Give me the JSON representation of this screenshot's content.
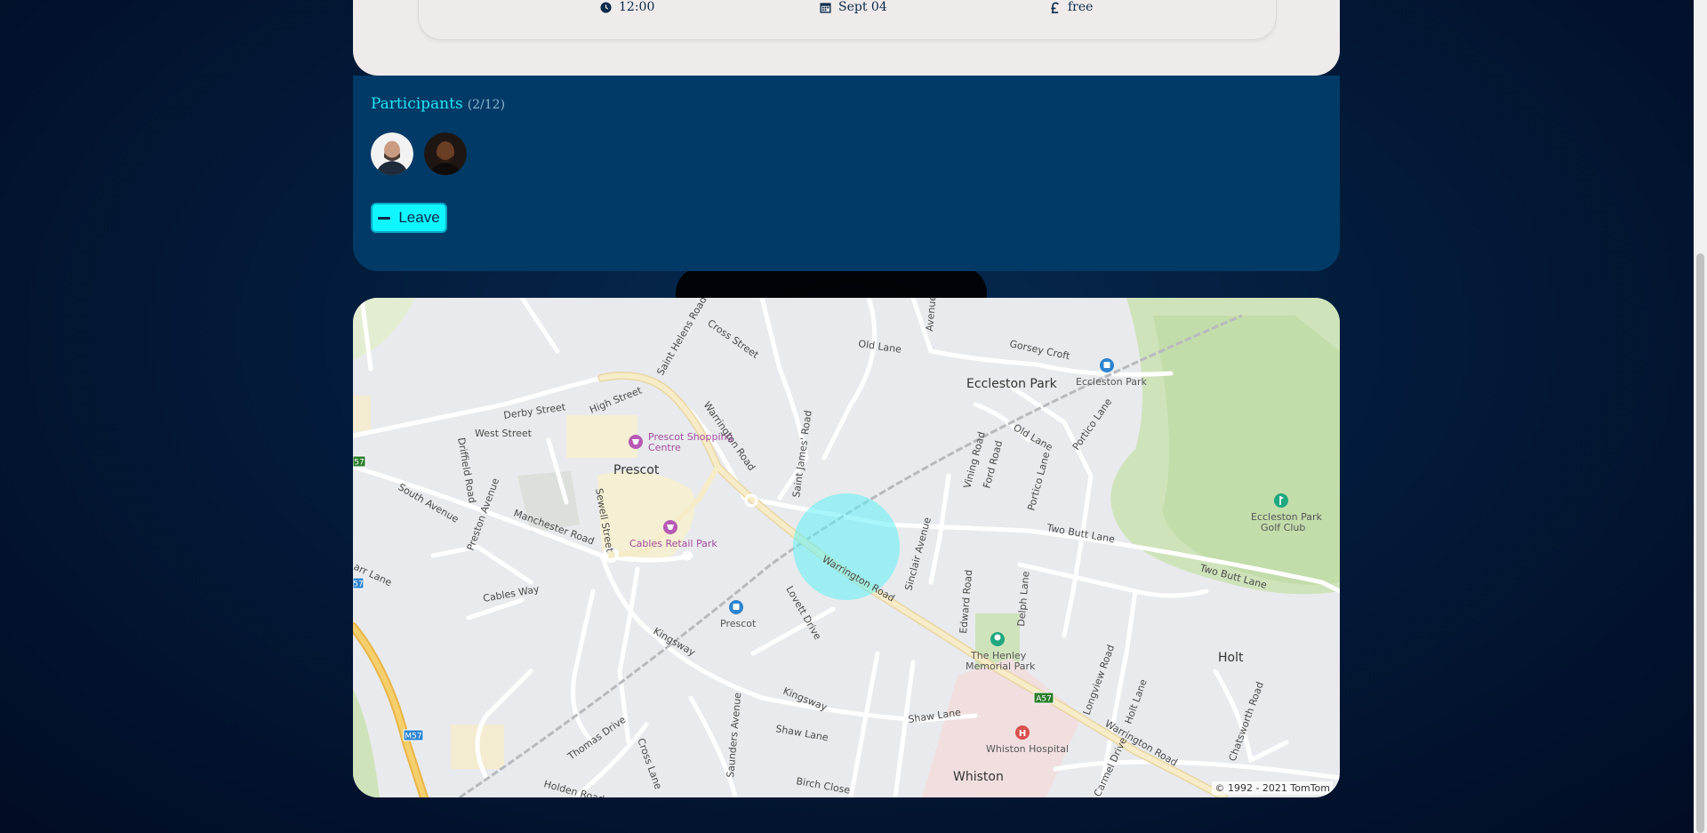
{
  "event_details": {
    "time": "12:00",
    "date": "Sept 04",
    "price": "free"
  },
  "participants": {
    "title": "Participants",
    "count": "(2/12)",
    "avatars": [
      "participant-1",
      "participant-2"
    ]
  },
  "leave_button": {
    "label": "Leave"
  },
  "map": {
    "copyright": "© 1992 - 2021 TomTom",
    "places": {
      "eccleston_park": "Eccleston Park",
      "eccleston_park_station": "Eccleston Park",
      "prescot": "Prescot",
      "prescot_station": "Prescot",
      "prescot_shopping": "Prescot Shopping",
      "prescot_centre": "Centre",
      "cables_retail": "Cables Retail Park",
      "henley_1": "The Henley",
      "henley_2": "Memorial Park",
      "whiston_hospital": "Whiston Hospital",
      "whiston": "Whiston",
      "holt": "Holt",
      "golf_1": "Eccleston Park",
      "golf_2": "Golf Club"
    },
    "roads": {
      "old_lane": "Old Lane",
      "old_lane_2": "Old Lane",
      "gorsey_croft": "Gorsey Croft",
      "cross_street": "Cross Street",
      "saint_helens_road": "Saint Helens Road",
      "derby_street": "Derby Street",
      "high_street": "High Street",
      "warrington_road_1": "Warrington Road",
      "warrington_road_2": "Warrington Road",
      "warrington_road_3": "Warrington Road",
      "west_street": "West Street",
      "driffield_road": "Driffield Road",
      "south_avenue": "South Avenue",
      "preston_avenue": "Preston Avenue",
      "manchester_road": "Manchester Road",
      "sewell_street": "Sewell Street",
      "saint_james_road": "Saint James' Road",
      "vining_road": "Vining Road",
      "ford_road": "Ford Road",
      "portico_lane": "Portico Lane",
      "portico_lane_2": "Portico Lane",
      "two_butt_lane": "Two Butt Lane",
      "two_butt_lane_2": "Two Butt Lane",
      "sinclair_avenue": "Sinclair Avenue",
      "edward_road": "Edward Road",
      "delph_lane": "Delph Lane",
      "lovett_drive": "Lovett Drive",
      "cables_way": "Cables Way",
      "kingsway": "Kingsway",
      "kingsway_2": "Kingsway",
      "shaw_lane": "Shaw Lane",
      "shaw_lane_2": "Shaw Lane",
      "longview_road": "Longview Road",
      "holt_lane": "Holt Lane",
      "chatsworth_road": "Chatsworth Road",
      "thomas_drive": "Thomas Drive",
      "cross_lane": "Cross Lane",
      "saunders_avenue": "Saunders Avenue",
      "birch_close": "Birch Close",
      "holden_road": "Holden Road",
      "carmel_drive": "Carmel Drive",
      "avenue": "Avenue",
      "arr_lane": "arr Lane",
      "a57": "A57",
      "a57_left": "57",
      "a57_left_2": "57",
      "m57": "M57"
    }
  }
}
